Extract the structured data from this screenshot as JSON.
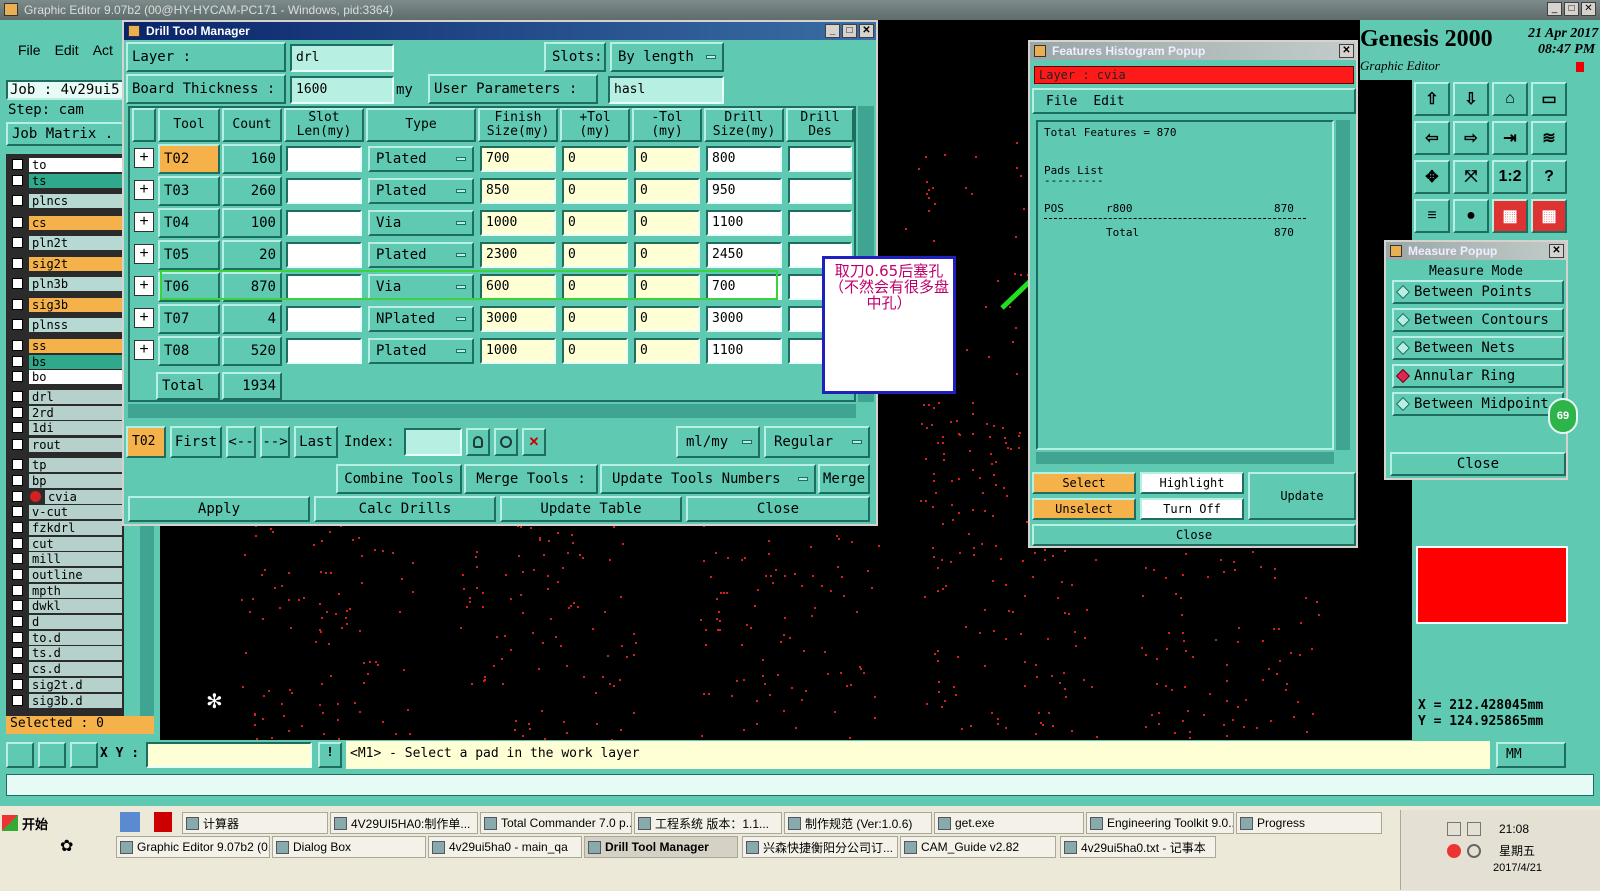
{
  "app": {
    "title": "Graphic Editor 9.07b2 (00@HY-HYCAM-PC171 - Windows, pid:3364)",
    "menu": [
      "File",
      "Edit",
      "Act"
    ],
    "job_label": "Job : 4v29ui5",
    "step_label": "Step: cam",
    "job_matrix": "Job Matrix .",
    "brand": "Genesis 2000",
    "brand_sub": "Graphic Editor",
    "date": "21 Apr 2017",
    "time": "08:47 PM",
    "selected": "Selected : 0",
    "xy_label": "X Y :",
    "status_msg": "<M1> - Select a pad in the work layer",
    "units": "MM",
    "coord_x": "X  =  212.428045mm",
    "coord_y": "Y  =  124.925865mm",
    "work_layer_color": "#d32020"
  },
  "layers": [
    {
      "name": "to",
      "color": "#ffffff"
    },
    {
      "name": "ts",
      "color": "#2fa88c"
    },
    {
      "name": "plncs",
      "color": "#b6d9d3"
    },
    {
      "name": "cs",
      "color": "#f5b24b"
    },
    {
      "name": "pln2t",
      "color": "#b6d9d3"
    },
    {
      "name": "sig2t",
      "color": "#f5b24b"
    },
    {
      "name": "pln3b",
      "color": "#b6d9d3"
    },
    {
      "name": "sig3b",
      "color": "#f5b24b"
    },
    {
      "name": "plnss",
      "color": "#b6d9d3"
    },
    {
      "name": "ss",
      "color": "#f5b24b"
    },
    {
      "name": "bs",
      "color": "#2fa88c"
    },
    {
      "name": "bo",
      "color": "#ffffff"
    },
    {
      "name": "drl",
      "color": "#b6d0cc"
    },
    {
      "name": "2rd",
      "color": "#b6d0cc"
    },
    {
      "name": "1di",
      "color": "#b6d0cc"
    },
    {
      "name": "rout",
      "color": "#b6d0cc"
    },
    {
      "name": "tp",
      "color": "#b6d0cc"
    },
    {
      "name": "bp",
      "color": "#b6d0cc"
    },
    {
      "name": "cvia",
      "color": "#b6d0cc"
    },
    {
      "name": "v-cut",
      "color": "#b6d0cc"
    },
    {
      "name": "fzkdrl",
      "color": "#b6d0cc"
    },
    {
      "name": "cut",
      "color": "#b6d0cc"
    },
    {
      "name": "mill",
      "color": "#b6d0cc"
    },
    {
      "name": "outline",
      "color": "#b6d0cc"
    },
    {
      "name": "mpth",
      "color": "#b6d0cc"
    },
    {
      "name": "dwkl",
      "color": "#b6d0cc"
    },
    {
      "name": "d",
      "color": "#b6d0cc"
    },
    {
      "name": "to.d",
      "color": "#b6d0cc"
    },
    {
      "name": "ts.d",
      "color": "#b6d0cc"
    },
    {
      "name": "cs.d",
      "color": "#b6d0cc"
    },
    {
      "name": "sig2t.d",
      "color": "#b6d0cc"
    },
    {
      "name": "sig3b.d",
      "color": "#b6d0cc"
    }
  ],
  "drill": {
    "title": "Drill Tool Manager",
    "layer_label": "Layer           :",
    "layer_value": "drl",
    "slots_label": "Slots:",
    "slots_value": "By length",
    "thickness_label": "Board Thickness :",
    "thickness_value": "1600",
    "thickness_unit": "my",
    "userparam_label": "User Parameters :",
    "userparam_value": "hasl",
    "headers": {
      "tool": "Tool",
      "count": "Count",
      "slot": "Slot\nLen(my)",
      "type": "Type",
      "finish": "Finish\nSize(my)",
      "ptol": "+Tol\n(my)",
      "mtol": "-Tol\n(my)",
      "drill": "Drill\nSize(my)",
      "des": "Drill\nDes"
    },
    "rows": [
      {
        "tool": "T02",
        "count": "160",
        "type": "Plated",
        "finish": "700",
        "ptol": "0",
        "mtol": "0",
        "drill": "800"
      },
      {
        "tool": "T03",
        "count": "260",
        "type": "Plated",
        "finish": "850",
        "ptol": "0",
        "mtol": "0",
        "drill": "950"
      },
      {
        "tool": "T04",
        "count": "100",
        "type": "Via",
        "finish": "1000",
        "ptol": "0",
        "mtol": "0",
        "drill": "1100"
      },
      {
        "tool": "T05",
        "count": "20",
        "type": "Plated",
        "finish": "2300",
        "ptol": "0",
        "mtol": "0",
        "drill": "2450"
      },
      {
        "tool": "T06",
        "count": "870",
        "type": "Via",
        "finish": "600",
        "ptol": "0",
        "mtol": "0",
        "drill": "700"
      },
      {
        "tool": "T07",
        "count": "4",
        "type": "NPlated",
        "finish": "3000",
        "ptol": "0",
        "mtol": "0",
        "drill": "3000"
      },
      {
        "tool": "T08",
        "count": "520",
        "type": "Plated",
        "finish": "1000",
        "ptol": "0",
        "mtol": "0",
        "drill": "1100"
      }
    ],
    "total_label": "Total",
    "total_value": "1934",
    "nav": {
      "current": "T02",
      "first": "First",
      "prev": "<--",
      "next": "-->",
      "last": "Last",
      "index": "Index:",
      "unit": "ml/my",
      "mode": "Regular"
    },
    "combine": "Combine Tools",
    "merge_label": "Merge Tools :",
    "merge_value": "Update Tools Numbers",
    "merge": "Merge",
    "apply": "Apply",
    "calc": "Calc Drills",
    "update": "Update Table",
    "close": "Close"
  },
  "annotation": {
    "text": "取刀0.65后塞孔（不然会有很多盘中孔）"
  },
  "histogram": {
    "title": "Features Histogram Popup",
    "layer": "Layer  :  cvia",
    "menu": [
      "File",
      "Edit"
    ],
    "total": "Total Features = 870",
    "pads": "Pads List",
    "underline": "---------",
    "pos": "POS",
    "sym": "r800",
    "cnt": "870",
    "total_lbl": "Total",
    "total_cnt": "870",
    "select": "Select",
    "highlight": "Highlight",
    "unselect": "Unselect",
    "turnoff": "Turn Off",
    "update": "Update",
    "close": "Close"
  },
  "measure": {
    "title": "Measure Popup",
    "mode": "Measure Mode",
    "items": [
      "Between Points",
      "Between Contours",
      "Between Nets",
      "Annular Ring",
      "Between Midpoint"
    ],
    "close": "Close",
    "badge": "69"
  },
  "taskbar": {
    "start": "开始",
    "row1": [
      "计算器",
      "4V29UI5HA0:制作单...",
      "Total Commander 7.0 p...",
      "工程系统  版本：1.1...",
      "制作规范 (Ver:1.0.6)",
      "get.exe",
      "Engineering Toolkit 9.0...",
      "Progress"
    ],
    "row2": [
      "Graphic Editor 9.07b2 (0...",
      "Dialog Box",
      "4v29ui5ha0 - main_qa",
      "Drill Tool Manager",
      "兴森快捷衡阳分公司订...",
      "CAM_Guide v2.82",
      "4v29ui5ha0.txt - 记事本"
    ],
    "clock": "21:08",
    "day": "星期五",
    "date": "2017/4/21"
  }
}
